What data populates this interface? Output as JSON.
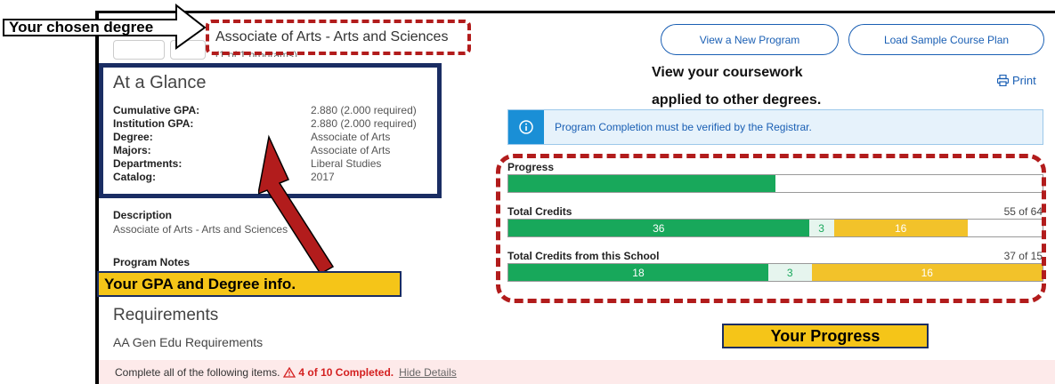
{
  "callouts": {
    "chosen_degree": "Your chosen degree",
    "gpa_degree_info": "Your GPA and Degree info.",
    "your_progress": "Your Progress",
    "view_coursework_line1": "View your coursework",
    "view_coursework_line2": "applied to other degrees."
  },
  "program": {
    "title": "Associate of Arts - Arts and Sciences",
    "count": "(1 of 1 programs)"
  },
  "buttons": {
    "view_new_program": "View a New Program",
    "load_sample_plan": "Load Sample Course Plan",
    "print": "Print"
  },
  "glance": {
    "title": "At a Glance",
    "rows": [
      {
        "label": "Cumulative GPA:",
        "value": "2.880 (2.000 required)"
      },
      {
        "label": "Institution GPA:",
        "value": "2.880 (2.000 required)"
      },
      {
        "label": "Degree:",
        "value": "Associate of Arts"
      },
      {
        "label": "Majors:",
        "value": "Associate of Arts"
      },
      {
        "label": "Departments:",
        "value": "Liberal Studies"
      },
      {
        "label": "Catalog:",
        "value": "2017"
      }
    ]
  },
  "description": {
    "heading": "Description",
    "text": "Associate of Arts - Arts and Sciences"
  },
  "program_notes": {
    "heading": "Program Notes"
  },
  "requirements": {
    "title": "Requirements",
    "subtitle": "AA Gen Edu Requirements",
    "completion_text": "Complete all of the following items.",
    "completion_status": "4 of 10 Completed.",
    "hide_details": "Hide Details"
  },
  "alert": {
    "text": "Program Completion must be verified by the Registrar."
  },
  "progress": {
    "label": "Progress",
    "fraction": 0.5
  },
  "total_credits": {
    "label": "Total Credits",
    "count": "55 of 64",
    "max": 64,
    "segments": [
      {
        "value": 36,
        "label": "36",
        "kind": "green"
      },
      {
        "value": 3,
        "label": "3",
        "kind": "mint"
      },
      {
        "value": 16,
        "label": "16",
        "kind": "yellow"
      }
    ]
  },
  "school_credits": {
    "label": "Total Credits from this School",
    "count": "37 of 15",
    "max": 37,
    "segments": [
      {
        "value": 18,
        "label": "18",
        "kind": "green"
      },
      {
        "value": 3,
        "label": "3",
        "kind": "mint"
      },
      {
        "value": 16,
        "label": "16",
        "kind": "yellow"
      }
    ]
  },
  "colors": {
    "accent_blue": "#1a5fb4",
    "complete_green": "#18a85b",
    "pending_yellow": "#f2c22a",
    "annotation_red": "#b21c1c",
    "annotation_navy": "#1a2d63",
    "callout_yellow": "#f5c518"
  },
  "icons": {
    "alert": "info-circle-icon",
    "print": "printer-icon",
    "warning": "warning-triangle-icon"
  }
}
